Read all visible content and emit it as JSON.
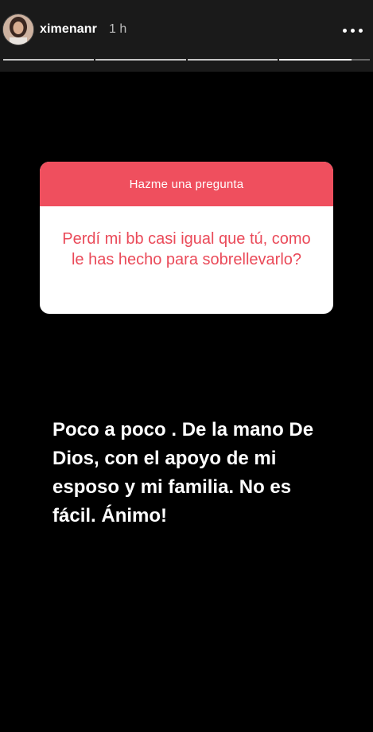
{
  "header": {
    "username": "ximenanr",
    "timestamp": "1 h"
  },
  "progress": {
    "segments_total": 4,
    "current_segment": 4,
    "current_fill_fraction": 0.8
  },
  "question_sticker": {
    "prompt": "Hazme una pregunta",
    "question": "Perdí mi bb casi igual que tú, como le has hecho para sobrellevarlo?",
    "accent_color": "#ef4f5e"
  },
  "answer_text": "Poco a poco . De la mano De Dios, con el apoyo de mi esposo y mi familia. No es fácil.  Ánimo!",
  "icons": {
    "more": "more-options-icon"
  }
}
